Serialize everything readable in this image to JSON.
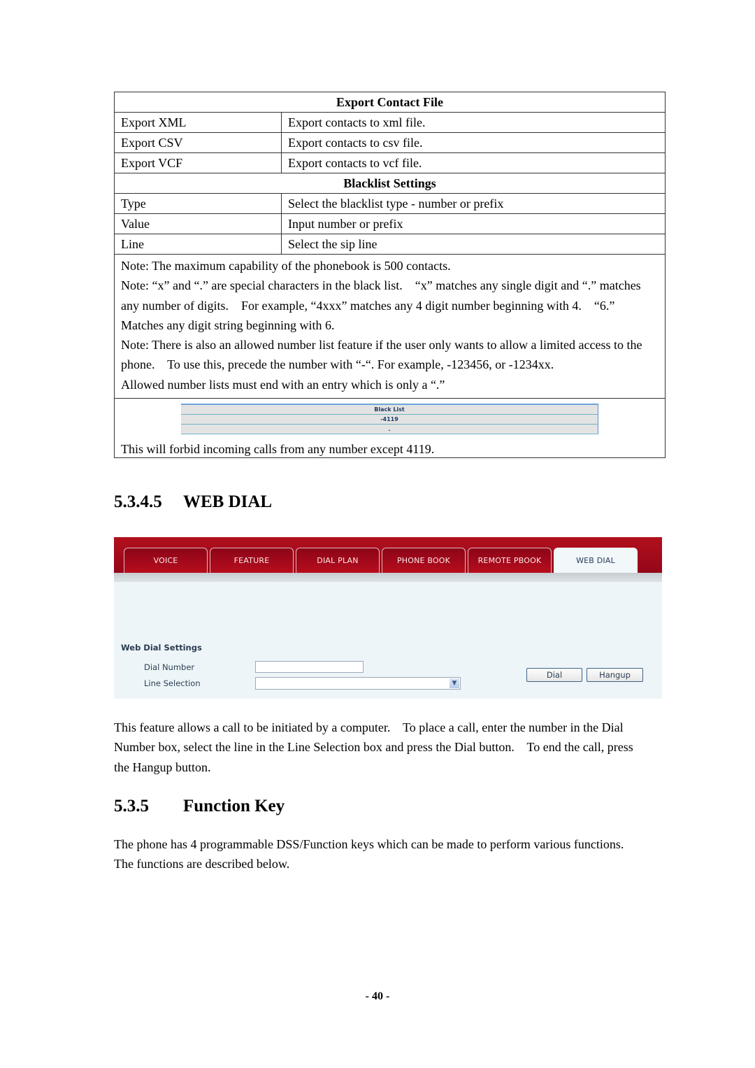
{
  "reference_table": {
    "export_section_title": "Export Contact File",
    "export_rows": [
      {
        "item": "Export XML",
        "description": "Export contacts to xml file."
      },
      {
        "item": "Export CSV",
        "description": "Export contacts to csv file."
      },
      {
        "item": "Export VCF",
        "description": "Export contacts to vcf file."
      }
    ],
    "blacklist_section_title": "Blacklist Settings",
    "blacklist_rows": [
      {
        "item": "Type",
        "description": "Select the blacklist type - number or prefix"
      },
      {
        "item": "Value",
        "description": "Input number or prefix"
      },
      {
        "item": "Line",
        "description": "Select the sip line"
      }
    ],
    "notes": [
      "Note: The maximum capability of the phonebook is 500 contacts.",
      "Note: “x” and “.” are special characters in the black list.    “x” matches any single digit and “.” matches any number of digits.    For example, “4xxx” matches any 4 digit number beginning with 4.    “6.” Matches any digit string beginning with 6.",
      "Note: There is also an allowed number list feature if the user only wants to allow a limited access to the phone.    To use this, precede the number with “-“. For example, -123456, or -1234xx.",
      "Allowed number lists must end with an entry which is only a “.”"
    ],
    "blacklist_example": {
      "header": "Black List",
      "entries": [
        "-4119",
        "."
      ]
    },
    "example_caption": "This will forbid incoming calls from any number except 4119."
  },
  "section_web_dial": {
    "number": "5.3.4.5",
    "title": "WEB DIAL"
  },
  "web_ui": {
    "tabs": [
      {
        "label": "VOICE",
        "active": false
      },
      {
        "label": "FEATURE",
        "active": false
      },
      {
        "label": "DIAL PLAN",
        "active": false
      },
      {
        "label": "PHONE BOOK",
        "active": false
      },
      {
        "label": "REMOTE PBOOK",
        "active": false
      },
      {
        "label": "WEB DIAL",
        "active": true
      }
    ],
    "settings_title": "Web Dial Settings",
    "dial_number_label": "Dial Number",
    "dial_number_value": "",
    "line_selection_label": "Line Selection",
    "line_selection_value": "",
    "dial_button": "Dial",
    "hangup_button": "Hangup",
    "colors": {
      "tab_bar": "#a30a1b",
      "active_tab": "#f2f7fa",
      "panel_bg": "#eef5f8"
    }
  },
  "web_dial_description": "This feature allows a call to be initiated by a computer.    To place a call, enter the number in the Dial Number box, select the line in the Line Selection box and press the Dial button.    To end the call, press the Hangup button.",
  "section_function_key": {
    "number": "5.3.5",
    "title": "Function Key"
  },
  "function_key_description": "The phone has 4 programmable DSS/Function keys which can be made to perform various functions. The functions are described below.",
  "page_number": "- 40 -"
}
